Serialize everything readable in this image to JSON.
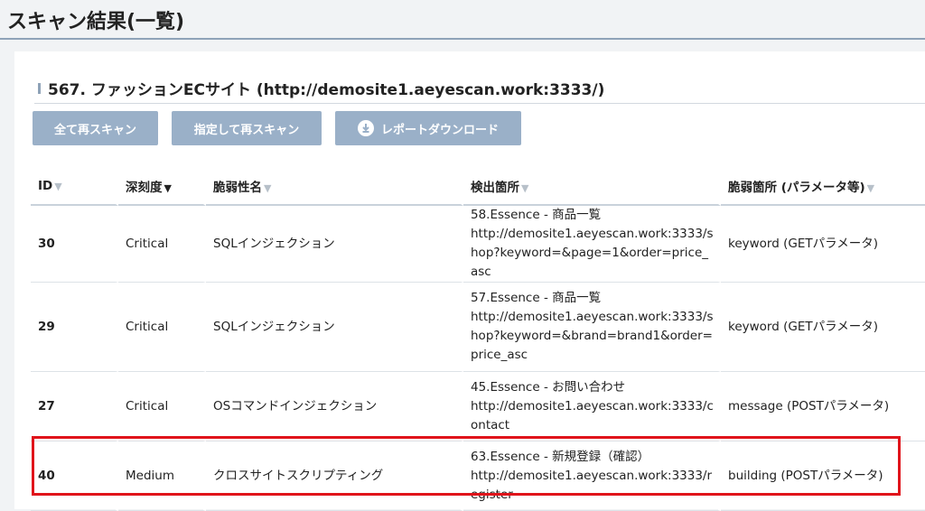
{
  "page": {
    "title": "スキャン結果(一覧)"
  },
  "site": {
    "title": "567. ファッションECサイト (http://demosite1.aeyescan.work:3333/)"
  },
  "toolbar": {
    "rescan_all_label": "全て再スキャン",
    "rescan_selected_label": "指定して再スキャン",
    "report_download_label": "レポートダウンロード"
  },
  "table": {
    "headers": {
      "id": "ID",
      "severity": "深刻度",
      "vuln_name": "脆弱性名",
      "location": "検出箇所",
      "param": "脆弱箇所 (パラメータ等)"
    },
    "rows": [
      {
        "id": "30",
        "severity": "Critical",
        "vuln_name": "SQLインジェクション",
        "location_page": "58.Essence - 商品一覧",
        "location_url": "http://demosite1.aeyescan.work:3333/shop?keyword=&page=1&order=price_asc",
        "param": "keyword (GETパラメータ)"
      },
      {
        "id": "29",
        "severity": "Critical",
        "vuln_name": "SQLインジェクション",
        "location_page": "57.Essence - 商品一覧",
        "location_url": "http://demosite1.aeyescan.work:3333/shop?keyword=&brand=brand1&order=price_asc",
        "param": "keyword (GETパラメータ)"
      },
      {
        "id": "27",
        "severity": "Critical",
        "vuln_name": "OSコマンドインジェクション",
        "location_page": "45.Essence - お問い合わせ",
        "location_url": "http://demosite1.aeyescan.work:3333/contact",
        "param": "message (POSTパラメータ)"
      },
      {
        "id": "40",
        "severity": "Medium",
        "vuln_name": "クロスサイトスクリプティング",
        "location_page": "63.Essence - 新規登録（確認）",
        "location_url": "http://demosite1.aeyescan.work:3333/register",
        "param": "building (POSTパラメータ)"
      }
    ]
  },
  "colors": {
    "accent": "#9ab0c8",
    "critical": "#b5302a",
    "medium": "#c08a1c",
    "highlight": "#e0141b"
  },
  "icons": {
    "sort": "sort-triangle-icon",
    "download": "download-circle-icon"
  }
}
